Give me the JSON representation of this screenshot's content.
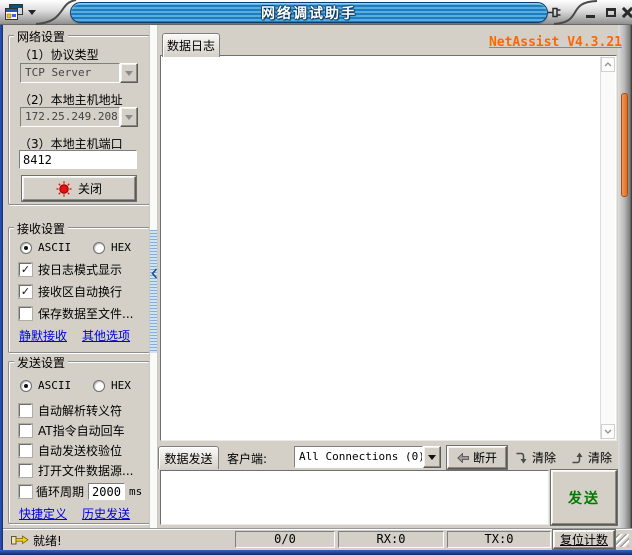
{
  "titlebar": {
    "title": "网络调试助手"
  },
  "net": {
    "title": "网络设置",
    "protocol_label": "（1）协议类型",
    "protocol_value": "TCP Server",
    "host_label": "（2）本地主机地址",
    "host_value": "172.25.249.208",
    "port_label": "（3）本地主机端口",
    "port_value": "8412",
    "close_button": "关闭"
  },
  "recv": {
    "title": "接收设置",
    "ascii": "ASCII",
    "hex": "HEX",
    "checks": [
      {
        "label": "按日志模式显示",
        "mark": "✓"
      },
      {
        "label": "接收区自动换行",
        "mark": "✓"
      },
      {
        "label": "保存数据至文件...",
        "mark": ""
      }
    ],
    "link_silent": "静默接收",
    "link_options": "其他选项"
  },
  "send": {
    "title": "发送设置",
    "ascii": "ASCII",
    "hex": "HEX",
    "checks": [
      {
        "label": "自动解析转义符",
        "mark": ""
      },
      {
        "label": "AT指令自动回车",
        "mark": ""
      },
      {
        "label": "自动发送校验位",
        "mark": ""
      },
      {
        "label": "打开文件数据源...",
        "mark": ""
      }
    ],
    "cycle": {
      "mark": "",
      "label": "循环周期",
      "value": "2000",
      "unit": "ms"
    },
    "link_quick": "快捷定义",
    "link_history": "历史发送"
  },
  "log": {
    "tab": "数据日志",
    "version": "NetAssist V4.3.21",
    "content": ""
  },
  "tx": {
    "tab": "数据发送",
    "client_label": "客户端:",
    "client_value": "All Connections (0)",
    "disconnect": "断开",
    "clear_recv": "清除",
    "clear_send": "清除",
    "send_button": "发送",
    "input_value": ""
  },
  "status": {
    "ready": "就绪!",
    "counter": "0/0",
    "rx": "RX:0",
    "tx": "TX:0",
    "reset": "复位计数"
  },
  "colors": {
    "accent_orange": "#ff6600",
    "link_blue": "#0000dd",
    "send_green": "#007a00",
    "led_red": "#e81010",
    "stripe_dark": "#1d7cc0",
    "stripe_light": "#5aaede"
  }
}
